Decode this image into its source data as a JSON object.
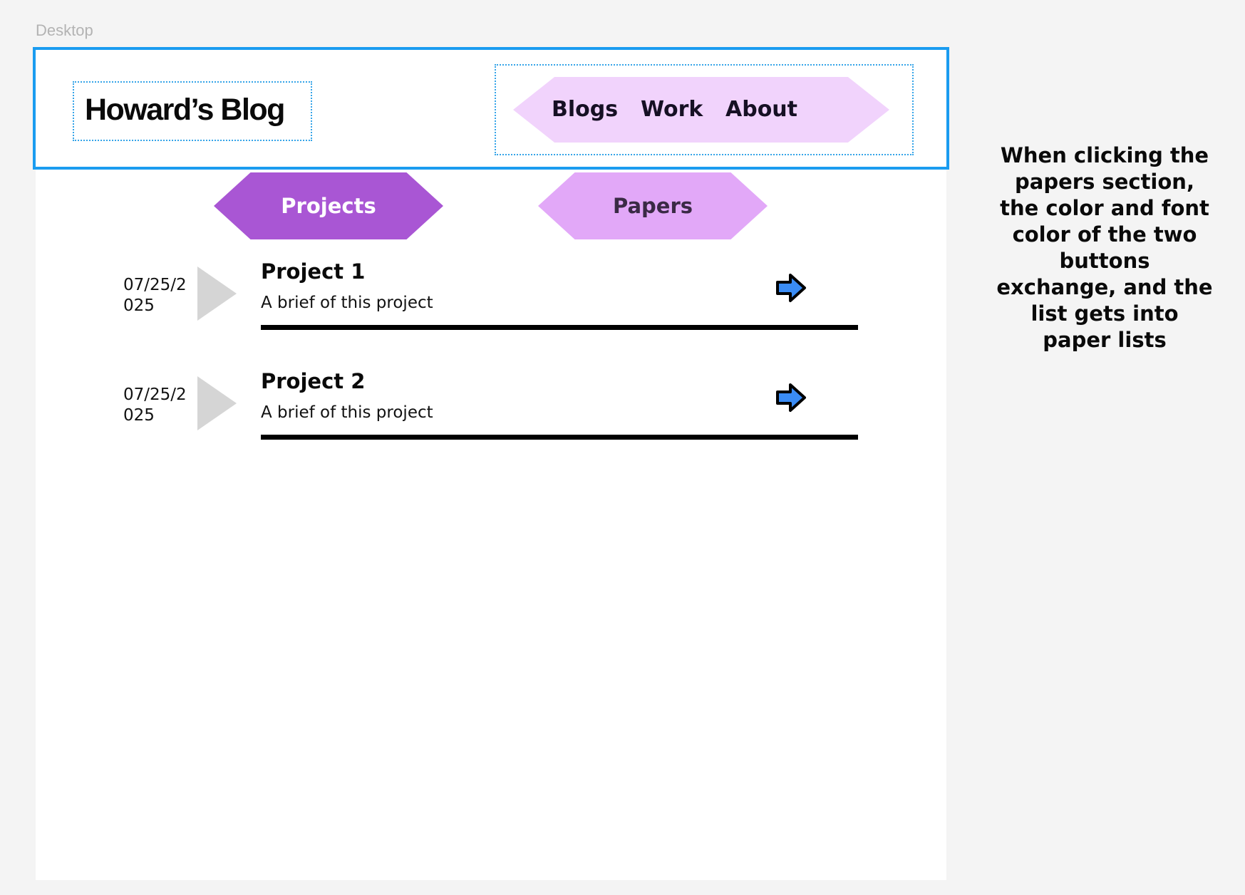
{
  "canvas": {
    "frame_label": "Desktop"
  },
  "header": {
    "logo": "Howard’s Blog",
    "nav": [
      {
        "label": "Blogs"
      },
      {
        "label": "Work"
      },
      {
        "label": "About"
      }
    ]
  },
  "tabs": {
    "projects": {
      "label": "Projects",
      "state": "active"
    },
    "papers": {
      "label": "Papers",
      "state": "inactive"
    }
  },
  "list": [
    {
      "date": "07/25/2025",
      "title": "Project 1",
      "brief": "A brief of this project",
      "icon": "arrow-right-icon"
    },
    {
      "date": "07/25/2025",
      "title": "Project 2",
      "brief": "A brief of this project",
      "icon": "arrow-right-icon"
    }
  ],
  "annotation": "When clicking the papers section, the color and font color of the two buttons exchange, and the list gets into paper lists",
  "colors": {
    "header_border": "#1a9cf0",
    "nav_bg": "#f1d3fc",
    "tab_active_bg": "#a956d4",
    "tab_inactive_bg": "#e2a8f8",
    "arrow_fill": "#3a8cf5",
    "triangle": "#d5d5d5"
  }
}
